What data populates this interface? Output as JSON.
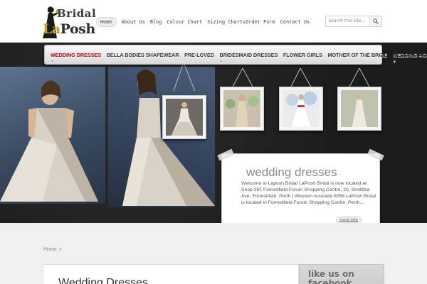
{
  "site": {
    "logo_line1": "Bridal",
    "logo_la": "La",
    "logo_line2": "Posh"
  },
  "topnav": {
    "items": [
      {
        "label": "Home",
        "active": true
      },
      {
        "label": "About Us"
      },
      {
        "label": "Blog"
      },
      {
        "label": "Colour Chart"
      },
      {
        "label": "Sizing Charts"
      },
      {
        "label": "Order Form"
      },
      {
        "label": "Contact Us"
      }
    ]
  },
  "search": {
    "placeholder": "search this site...",
    "icon": "magnifier-icon"
  },
  "catnav": {
    "items": [
      {
        "label": "WEDDING DRESSES",
        "active": true
      },
      {
        "label": "BELLA BODIES SHAPEWEAR"
      },
      {
        "label": "PRE-LOVED"
      },
      {
        "label": "BRIDESMAID DRESSES"
      },
      {
        "label": "FLOWER GIRLS"
      },
      {
        "label": "MOTHER OF THE BRIDE"
      },
      {
        "label": "WEDDING ACCESSORIES"
      }
    ]
  },
  "featured": {
    "title": "wedding dresses",
    "body": "Welcome to Laposh Bridal LaPosh Bridal is now located at Shop 26f, Forrestfield Forum Shopping Centre, 20, Strelitzia Ave, Forrestfield. Perth | Western Australia 6058 LaPosh Bridal is located in Forrestfield Forum Shopping Centre, Perth,...",
    "more_label": "more info"
  },
  "breadcrumb": {
    "home": "Home",
    "separator": "»"
  },
  "content": {
    "page_title": "Wedding Dresses"
  },
  "sidebar": {
    "widget_title_line1": "like us on",
    "widget_title_line2": "facebook"
  },
  "colors": {
    "accent": "#b30000",
    "gold": "#c9a227",
    "dark_bg": "#1f1f1f"
  }
}
